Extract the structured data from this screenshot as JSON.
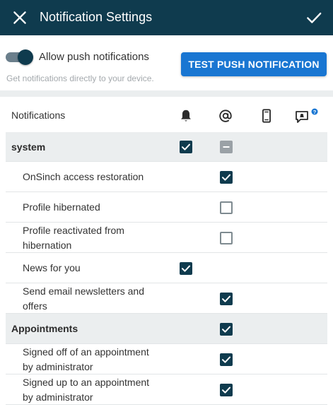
{
  "header": {
    "title": "Notification Settings",
    "close_icon": "close-icon",
    "confirm_icon": "check-icon",
    "color": "#0f3b4e"
  },
  "push": {
    "toggle_on": true,
    "label": "Allow push notifications",
    "subtitle": "Get notifications directly to your device.",
    "test_button": "TEST PUSH NOTIFICATION",
    "button_color": "#1976d2"
  },
  "table": {
    "column_header": "Notifications",
    "columns": [
      "bell-icon",
      "at-sign-icon",
      "mobile-phone-icon",
      "chat-help-icon"
    ],
    "rows": [
      {
        "label": "system",
        "group": true,
        "bell": "checked",
        "email": "indeterminate"
      },
      {
        "label": "OnSinch access restoration",
        "group": false,
        "bell": "",
        "email": "checked"
      },
      {
        "label": "Profile hibernated",
        "group": false,
        "bell": "",
        "email": "unchecked"
      },
      {
        "label": "Profile reactivated from hibernation",
        "group": false,
        "bell": "",
        "email": "unchecked"
      },
      {
        "label": "News for you",
        "group": false,
        "bell": "checked",
        "email": ""
      },
      {
        "label": "Send email newsletters and offers",
        "group": false,
        "bell": "",
        "email": "checked"
      },
      {
        "label": "Appointments",
        "group": true,
        "bell": "",
        "email": "checked"
      },
      {
        "label": "Signed off of an appointment by administrator",
        "group": false,
        "bell": "",
        "email": "checked"
      },
      {
        "label": "Signed up to an appointment by administrator",
        "group": false,
        "bell": "",
        "email": "checked"
      }
    ]
  }
}
